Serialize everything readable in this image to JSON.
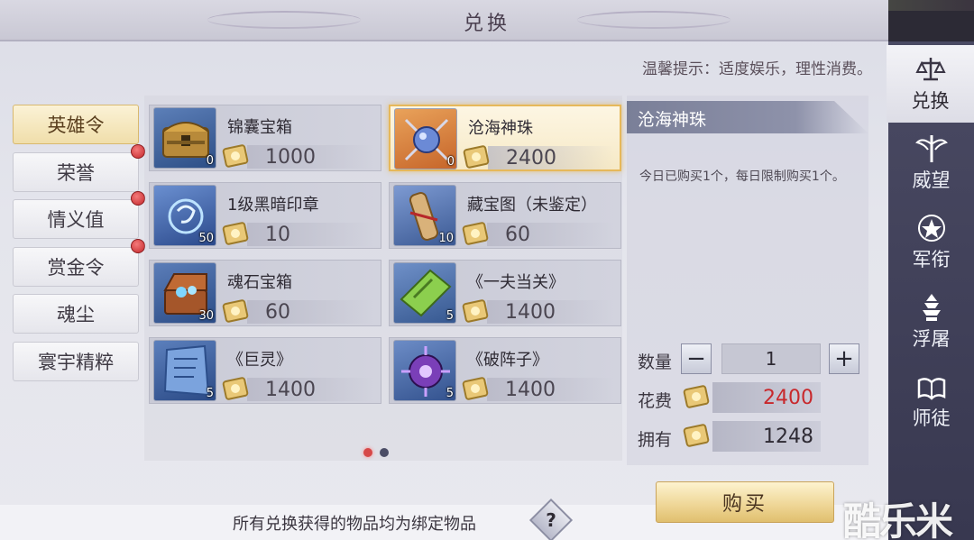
{
  "header": {
    "title": "兑换"
  },
  "tip": "温馨提示：适度娱乐，理性消费。",
  "categories": [
    {
      "label": "英雄令",
      "active": true,
      "badge": false
    },
    {
      "label": "荣誉",
      "active": false,
      "badge": true
    },
    {
      "label": "情义值",
      "active": false,
      "badge": true
    },
    {
      "label": "赏金令",
      "active": false,
      "badge": true
    },
    {
      "label": "魂尘",
      "active": false,
      "badge": false
    },
    {
      "label": "寰宇精粹",
      "active": false,
      "badge": false
    }
  ],
  "items": [
    {
      "name": "锦囊宝箱",
      "price": "1000",
      "qty": "0",
      "icon": "treasure-chest-icon"
    },
    {
      "name": "沧海神珠",
      "price": "2400",
      "qty": "0",
      "icon": "pearl-icon",
      "selected": true
    },
    {
      "name": "1级黑暗印章",
      "price": "10",
      "qty": "50",
      "icon": "dark-seal-icon"
    },
    {
      "name": "藏宝图（未鉴定）",
      "price": "60",
      "qty": "10",
      "icon": "treasure-map-icon"
    },
    {
      "name": "魂石宝箱",
      "price": "60",
      "qty": "30",
      "icon": "soulstone-chest-icon"
    },
    {
      "name": "《一夫当关》",
      "price": "1400",
      "qty": "5",
      "icon": "green-scroll-icon"
    },
    {
      "name": "《巨灵》",
      "price": "1400",
      "qty": "5",
      "icon": "blue-tablet-icon"
    },
    {
      "name": "《破阵子》",
      "price": "1400",
      "qty": "5",
      "icon": "purple-sigil-icon"
    }
  ],
  "pager": {
    "current": 1,
    "total": 2
  },
  "detail": {
    "name": "沧海神珠",
    "desc": "今日已购买1个，每日限制购买1个。",
    "qty_label": "数量",
    "quantity": "1",
    "minus": "−",
    "plus": "+",
    "cost_label": "花费",
    "cost": "2400",
    "own_label": "拥有",
    "owned": "1248"
  },
  "buy_label": "购买",
  "footer_note": "所有兑换获得的物品均为绑定物品",
  "help": "?",
  "tabs": [
    {
      "label": "兑换",
      "icon": "scales-icon",
      "active": true
    },
    {
      "label": "威望",
      "icon": "winged-sword-icon",
      "active": false
    },
    {
      "label": "军衔",
      "icon": "star-badge-icon",
      "active": false
    },
    {
      "label": "浮屠",
      "icon": "pagoda-icon",
      "active": false
    },
    {
      "label": "师徒",
      "icon": "book-icon",
      "active": false
    }
  ],
  "watermark": "酷乐米",
  "colors": {
    "accent_gold": "#e6b85a",
    "price_red": "#c8282c",
    "tab_bg": "#4a4a63"
  }
}
